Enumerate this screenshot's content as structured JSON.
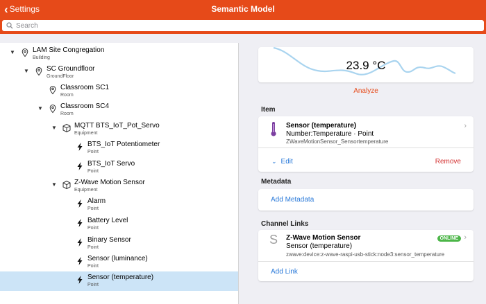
{
  "header": {
    "back_label": "Settings",
    "title": "Semantic Model"
  },
  "search": {
    "placeholder": "Search",
    "value": ""
  },
  "tree": {
    "nodes": [
      {
        "label": "LAM Site Congregation",
        "sub": "Building"
      },
      {
        "label": "SC Groundfloor",
        "sub": "GroundFloor"
      },
      {
        "label": "Classroom SC1",
        "sub": "Room"
      },
      {
        "label": "Classroom SC4",
        "sub": "Room"
      },
      {
        "label": "MQTT BTS_IoT_Pot_Servo",
        "sub": "Equipment"
      },
      {
        "label": "BTS_IoT Potentiometer",
        "sub": "Point"
      },
      {
        "label": "BTS_IoT Servo",
        "sub": "Point"
      },
      {
        "label": "Z-Wave Motion Sensor",
        "sub": "Equipment"
      },
      {
        "label": "Alarm",
        "sub": "Point"
      },
      {
        "label": "Battery Level",
        "sub": "Point"
      },
      {
        "label": "Binary Sensor",
        "sub": "Point"
      },
      {
        "label": "Sensor (luminance)",
        "sub": "Point"
      },
      {
        "label": "Sensor (temperature)",
        "sub": "Point"
      }
    ]
  },
  "state": {
    "value": "23.9 °C",
    "analyze_label": "Analyze"
  },
  "item_section": {
    "title": "Item",
    "name": "Sensor (temperature)",
    "type": "Number:Temperature · Point",
    "id": "ZWaveMotionSensor_Sensortemperature",
    "edit_label": "Edit",
    "remove_label": "Remove"
  },
  "metadata_section": {
    "title": "Metadata",
    "add_label": "Add Metadata"
  },
  "channel_section": {
    "title": "Channel Links",
    "letter": "S",
    "thing_name": "Z-Wave Motion Sensor",
    "status": "ONLINE",
    "channel_label": "Sensor (temperature)",
    "channel_uid": "zwave:device:z-wave-raspi-usb-stick:node3:sensor_temperature",
    "add_link_label": "Add Link"
  },
  "colors": {
    "accent": "#e64a19",
    "link": "#2979d9",
    "remove": "#d32f2f",
    "online": "#4cb648",
    "selected": "#cce4f7"
  }
}
